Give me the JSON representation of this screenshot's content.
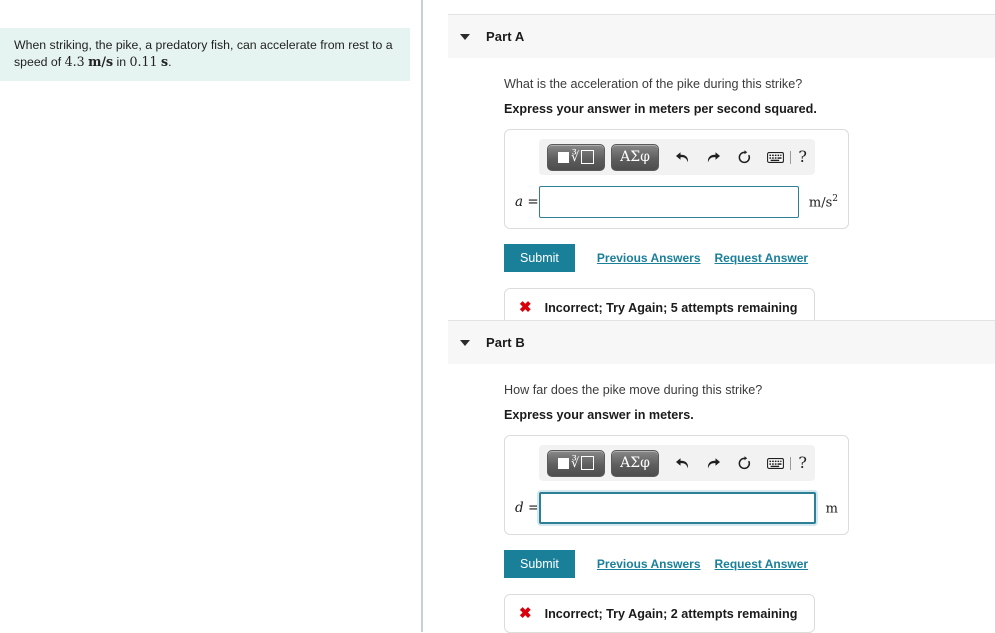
{
  "problem": {
    "text_before": "When striking, the pike, a predatory fish, can accelerate from rest to a speed of",
    "speed_value": "4.3",
    "speed_unit": "m/s",
    "text_middle": "in",
    "time_value": "0.11",
    "time_unit": "s",
    "text_end": "."
  },
  "mathbar": {
    "template_button_label": "template-button",
    "greek_button_label": "ΑΣφ",
    "undo_icon": "undo-arrow-icon",
    "redo_icon": "redo-arrow-icon",
    "reset_icon": "reset-circular-arrow-icon",
    "keyboard_icon": "keyboard-icon",
    "help_label": "?"
  },
  "actions": {
    "submit_label": "Submit",
    "previous_answers_label": "Previous Answers",
    "request_answer_label": "Request Answer"
  },
  "colors": {
    "accent_teal": "#1a7f99",
    "input_border": "#2d7f95",
    "error_red": "#d8000c",
    "panel_mint": "#e6f4f1",
    "header_gray": "#f7f7f7"
  },
  "parts": [
    {
      "title": "Part A",
      "question": "What is the acceleration of the pike during this strike?",
      "instruction": "Express your answer in meters per second squared.",
      "variable": "a",
      "equals": "=",
      "answer_value": "",
      "unit_base": "m/s",
      "unit_exponent": "2",
      "focused": false,
      "feedback": "Incorrect; Try Again; 5 attempts remaining",
      "feedback_icon": "error-x-icon"
    },
    {
      "title": "Part B",
      "question": "How far does the pike move during this strike?",
      "instruction": "Express your answer in meters.",
      "variable": "d",
      "equals": "=",
      "answer_value": "",
      "unit_base": "m",
      "unit_exponent": "",
      "focused": true,
      "feedback": "Incorrect; Try Again; 2 attempts remaining",
      "feedback_icon": "error-x-icon"
    }
  ]
}
